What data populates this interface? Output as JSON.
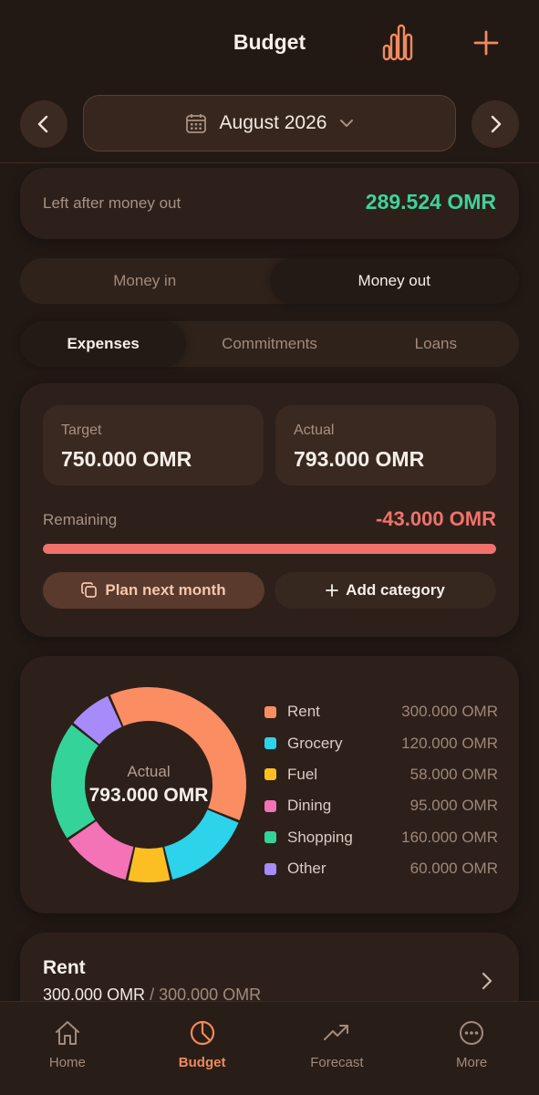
{
  "header": {
    "title": "Budget",
    "stats_icon": "bar-chart-icon",
    "add_icon": "plus-icon"
  },
  "month_picker": {
    "label": "August 2026",
    "prev_icon": "chevron-left-icon",
    "next_icon": "chevron-right-icon",
    "calendar_icon": "calendar-icon",
    "dropdown_icon": "chevron-down-icon"
  },
  "summary": {
    "label": "Left after money out",
    "value": "289.524 OMR",
    "value_color": "#3fd29b"
  },
  "money_toggle": {
    "options": [
      "Money in",
      "Money out"
    ],
    "selected": "Money out"
  },
  "category_tabs": {
    "options": [
      "Expenses",
      "Commitments",
      "Loans"
    ],
    "selected": "Expenses"
  },
  "budget": {
    "target_label": "Target",
    "target_value": "750.000 OMR",
    "actual_label": "Actual",
    "actual_value": "793.000 OMR",
    "remaining_label": "Remaining",
    "remaining_value": "-43.000 OMR",
    "progress_fraction": 1.0,
    "plan_button": "Plan next month",
    "add_button": "Add category"
  },
  "chart_data": {
    "type": "pie",
    "center_label": "Actual",
    "center_value": "793.000 OMR",
    "categories": [
      "Rent",
      "Grocery",
      "Fuel",
      "Dining",
      "Shopping",
      "Other"
    ],
    "values": [
      300,
      120,
      58,
      95,
      160,
      60
    ],
    "value_labels": [
      "300.000 OMR",
      "120.000 OMR",
      "58.000 OMR",
      "95.000 OMR",
      "160.000 OMR",
      "60.000 OMR"
    ],
    "colors": [
      "#fb8d63",
      "#2cd3ea",
      "#fbbf24",
      "#f472b6",
      "#34d399",
      "#a78bfa"
    ]
  },
  "category_row": {
    "name": "Rent",
    "spent": "300.000 OMR",
    "separator": " / ",
    "budgeted": "300.000 OMR"
  },
  "tabbar": {
    "items": [
      {
        "label": "Home",
        "icon": "home-icon"
      },
      {
        "label": "Budget",
        "icon": "pie-chart-icon"
      },
      {
        "label": "Forecast",
        "icon": "trending-up-icon"
      },
      {
        "label": "More",
        "icon": "more-icon"
      }
    ],
    "active": "Budget",
    "active_color": "#f08a5d"
  }
}
